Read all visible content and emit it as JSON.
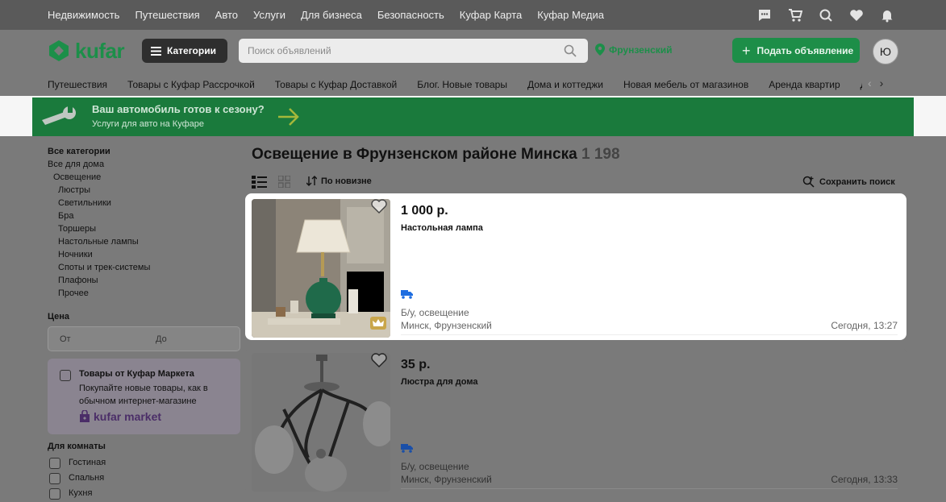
{
  "topbar": {
    "links": [
      "Недвижимость",
      "Путешествия",
      "Авто",
      "Услуги",
      "Для бизнеса",
      "Безопасность",
      "Куфар Карта",
      "Куфар Медиа"
    ],
    "icons": [
      "chat-icon",
      "cart-icon",
      "compare-icon",
      "heart-icon",
      "bell-icon"
    ]
  },
  "header": {
    "logo_text": "kufar",
    "categories_label": "Категории",
    "search_placeholder": "Поиск объявлений",
    "location": "Фрунзенский",
    "post_button": "Подать объявление",
    "avatar_letter": "Ю"
  },
  "catnav": {
    "items": [
      "Путешествия",
      "Товары с Куфар Рассрочкой",
      "Товары с Куфар Доставкой",
      "Блог. Новые товары",
      "Дома и коттеджи",
      "Новая мебель от магазинов",
      "Аренда квартир",
      "Д"
    ]
  },
  "banner": {
    "title": "Ваш автомобиль готов к сезону?",
    "subtitle": "Услуги для авто на Куфаре"
  },
  "sidebar": {
    "all_categories": "Все категории",
    "parent": "Все для дома",
    "current": "Освещение",
    "subcategories": [
      "Люстры",
      "Светильники",
      "Бра",
      "Торшеры",
      "Настольные лампы",
      "Ночники",
      "Споты и трек-системы",
      "Плафоны",
      "Прочее"
    ],
    "price_label": "Цена",
    "price_from_placeholder": "От",
    "price_to_placeholder": "До",
    "market_title": "Товары от Куфар Маркета",
    "market_desc": "Покупайте новые товары, как в обычном интернет-магазине",
    "market_logo": "kufar market",
    "rooms_label": "Для комнаты",
    "rooms": [
      "Гостиная",
      "Спальня",
      "Кухня"
    ]
  },
  "main": {
    "title": "Освещение в Фрунзенском районе Минска",
    "count": "1 198",
    "sort_label": "По новизне",
    "save_search": "Сохранить поиск"
  },
  "listings": [
    {
      "price": "1 000 р.",
      "title": "Настольная лампа",
      "condition": "Б/у, освещение",
      "location": "Минск, Фрунзенский",
      "date": "Сегодня, 13:27"
    },
    {
      "price": "35 р.",
      "title": "Люстра для дома",
      "condition": "Б/у, освещение",
      "location": "Минск, Фрунзенский",
      "date": "Сегодня, 13:33"
    }
  ],
  "colors": {
    "brand_green": "#1d8e48",
    "topbar": "#5a5a5a",
    "overlay": "#7a7a7a",
    "banner": "#1a7a3c"
  }
}
